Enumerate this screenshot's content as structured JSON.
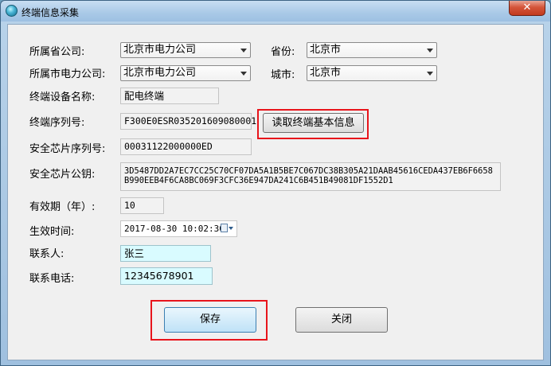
{
  "window": {
    "title": "终端信息采集",
    "close_glyph": "✕"
  },
  "form": {
    "province_company": {
      "label": "所属省公司:",
      "value": "北京市电力公司"
    },
    "province": {
      "label": "省份:",
      "value": "北京市"
    },
    "city_company": {
      "label": "所属市电力公司:",
      "value": "北京市电力公司"
    },
    "city": {
      "label": "城市:",
      "value": "北京市"
    },
    "device_name": {
      "label": "终端设备名称:",
      "value": "配电终端"
    },
    "serial_no": {
      "label": "终端序列号:",
      "value": "F300E0ESR035201609080001"
    },
    "chip_serial": {
      "label": "安全芯片序列号:",
      "value": "00031122000000ED"
    },
    "chip_pubkey": {
      "label": "安全芯片公钥:",
      "value": "3D5487DD2A7EC7CC25C70CF07DA5A1B5BE7C067DC38B305A21DAAB45616CEDA437EB6F6658\nB990EEB4F6CA8BC069F3CFC36E947DA241C6B451B49081DF1552D1"
    },
    "validity": {
      "label": "有效期（年）:",
      "value": "10"
    },
    "effective_time": {
      "label": "生效时间:",
      "value": "2017-08-30 10:02:30"
    },
    "contact": {
      "label": "联系人:",
      "value": "张三"
    },
    "phone": {
      "label": "联系电话:",
      "value": "12345678901"
    }
  },
  "buttons": {
    "read_info": "读取终端基本信息",
    "save": "保存",
    "close": "关闭"
  },
  "colors": {
    "highlight": "#e8141b",
    "edit_bg": "#d9fbff"
  }
}
